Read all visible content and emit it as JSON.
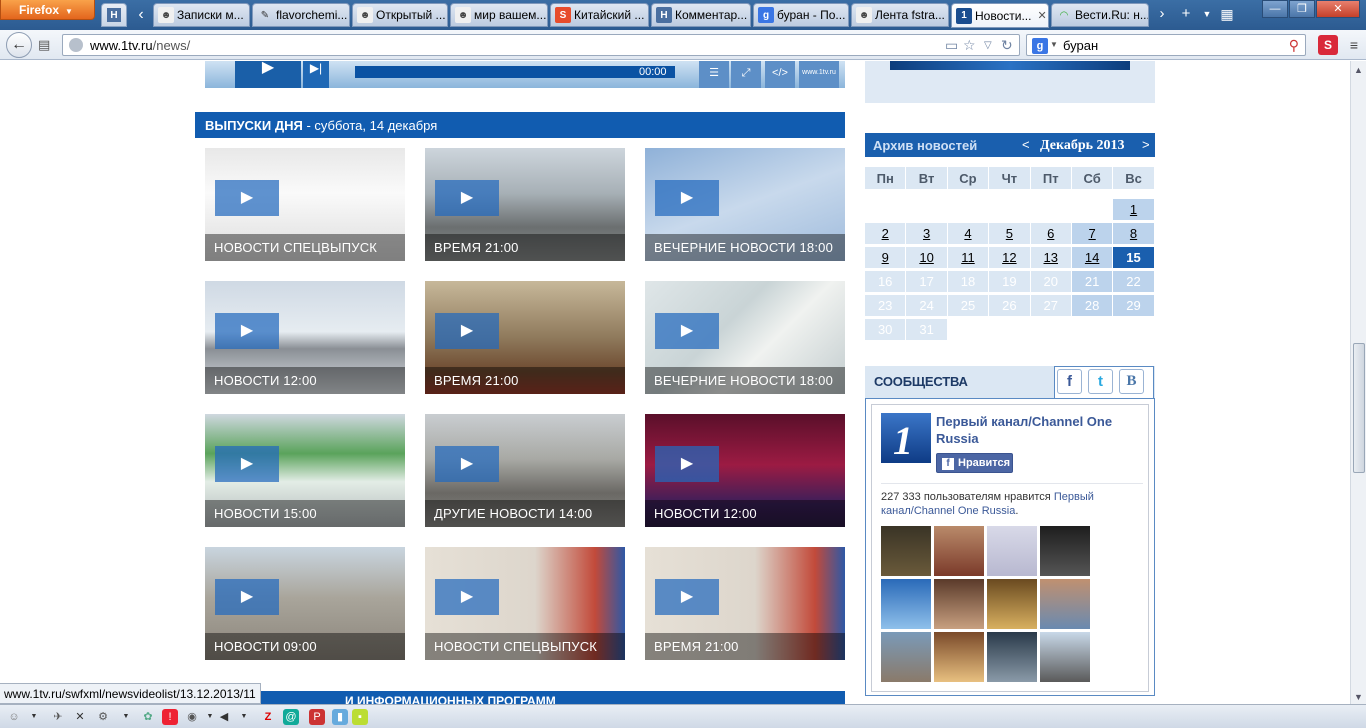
{
  "browser": {
    "menu_label": "Firefox",
    "tabs": [
      {
        "title": "Записки м...",
        "fav": "user-icon"
      },
      {
        "title": "flavorchemi...",
        "fav": "pen-icon"
      },
      {
        "title": "Открытый ...",
        "fav": "user-icon"
      },
      {
        "title": "мир вашем...",
        "fav": "user-icon"
      },
      {
        "title": "Китайский ...",
        "fav": "s-icon"
      },
      {
        "title": "Комментар...",
        "fav": "h-icon"
      },
      {
        "title": "буран - По...",
        "fav": "google-icon"
      },
      {
        "title": "Лента fstra...",
        "fav": "user-icon"
      },
      {
        "title": "Новости...",
        "fav": "channel-one-icon",
        "active": true
      },
      {
        "title": "Вести.Ru: н...",
        "fav": "loading-icon"
      }
    ],
    "url_host": "www.1tv.ru",
    "url_path": "/news/",
    "search_query": "буран",
    "status_url": "www.1tv.ru/swfxml/newsvideolist/13.12.2013/11"
  },
  "player": {
    "time": "00:00",
    "logo": "www.1tv.ru"
  },
  "section": {
    "title": "ВЫПУСКИ ДНЯ",
    "date": " - суббота, 14 декабря"
  },
  "videos": [
    {
      "caption": "НОВОСТИ СПЕЦВЫПУСК"
    },
    {
      "caption": "ВРЕМЯ 21:00"
    },
    {
      "caption": "ВЕЧЕРНИЕ НОВОСТИ 18:00"
    },
    {
      "caption": "НОВОСТИ 12:00"
    },
    {
      "caption": "ВРЕМЯ 21:00"
    },
    {
      "caption": "ВЕЧЕРНИЕ НОВОСТИ 18:00"
    },
    {
      "caption": "НОВОСТИ 15:00"
    },
    {
      "caption": "ДРУГИЕ НОВОСТИ 14:00"
    },
    {
      "caption": "НОВОСТИ 12:00"
    },
    {
      "caption": "НОВОСТИ 09:00"
    },
    {
      "caption": "НОВОСТИ СПЕЦВЫПУСК"
    },
    {
      "caption": "ВРЕМЯ 21:00"
    }
  ],
  "next_section": {
    "title": "И ИНФОРМАЦИОННЫХ ПРОГРАММ"
  },
  "calendar": {
    "title": "Архив новостей",
    "month": "Декабрь 2013",
    "prev": "<",
    "next": ">",
    "weekdays": [
      "Пн",
      "Вт",
      "Ср",
      "Чт",
      "Пт",
      "Сб",
      "Вс"
    ],
    "weeks": [
      [
        "",
        "",
        "",
        "",
        "",
        "",
        "1"
      ],
      [
        "2",
        "3",
        "4",
        "5",
        "6",
        "7",
        "8"
      ],
      [
        "9",
        "10",
        "11",
        "12",
        "13",
        "14",
        "15"
      ],
      [
        "16",
        "17",
        "18",
        "19",
        "20",
        "21",
        "22"
      ],
      [
        "23",
        "24",
        "25",
        "26",
        "27",
        "28",
        "29"
      ],
      [
        "30",
        "31",
        "",
        "",
        "",
        "",
        ""
      ]
    ],
    "today": "15"
  },
  "community": {
    "title": "СООБЩЕСТВА",
    "page_name": "Первый канал/Channel One Russia",
    "like_label": "Нравится",
    "count_text": "227 333 пользователям нравится ",
    "count_link": "Первый канал/Channel One Russia",
    "count_tail": "."
  }
}
